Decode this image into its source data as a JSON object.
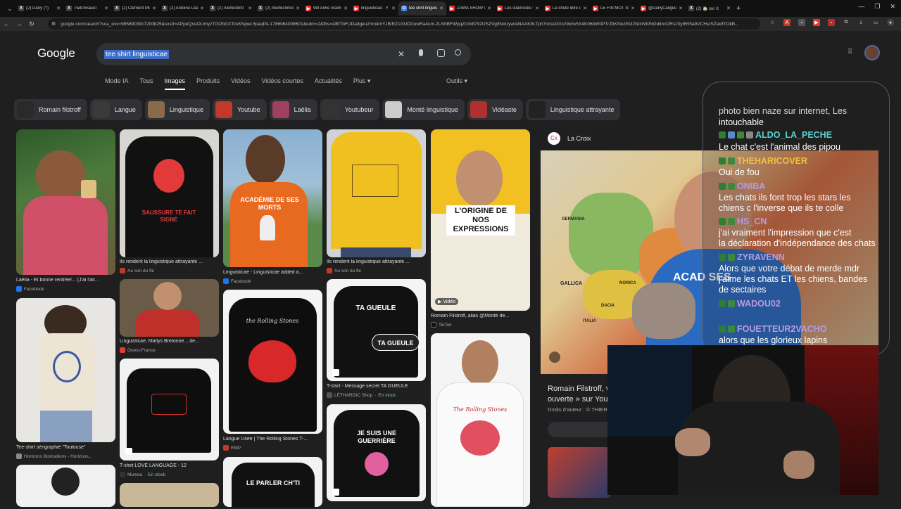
{
  "browser": {
    "tabs": [
      {
        "label": "(2) Dany (?)",
        "fav": "X",
        "color": "#444"
      },
      {
        "label": "TwitchSaucl",
        "fav": "X",
        "color": "#444"
      },
      {
        "label": "(2) Clément Mol",
        "fav": "X",
        "color": "#444"
      },
      {
        "label": "(2) Antoine Léau",
        "fav": "X",
        "color": "#444"
      },
      {
        "label": "(2) AlertesInfo",
        "fav": "X",
        "color": "#444"
      },
      {
        "label": "(2) AlertesInfos",
        "fav": "X",
        "color": "#444"
      },
      {
        "label": "Wil Aime vraiment",
        "fav": "▶",
        "color": "#e53935"
      },
      {
        "label": "linguisticae - Y",
        "fav": "▶",
        "color": "#e53935"
      },
      {
        "label": "tee shirt linguis",
        "fav": "G",
        "color": "#4285f4"
      },
      {
        "label": "ZAWA SHOW l",
        "fav": "▶",
        "color": "#e53935"
      },
      {
        "label": "Les islamistes s",
        "fav": "▶",
        "color": "#e53935"
      },
      {
        "label": "La chute libre d",
        "fav": "▶",
        "color": "#e53935"
      },
      {
        "label": "LE FIN MOT SUR",
        "fav": "▶",
        "color": "#e53935"
      },
      {
        "label": "@DanyCaligula",
        "fav": "▶",
        "color": "#e53935"
      },
      {
        "label": "(2) 🏠 sur X",
        "fav": "X",
        "color": "#444"
      }
    ],
    "active_tab": 8,
    "url": "google.com/search?sca_esv=98589039c7200b25&sxsrf=APpeQnuOUmyzTGl2bGXTcsKNpwL5paqPA:1786064008601&udm=2&fbs=ABfTbFUDadgeu2mn4mYJBIEZ1GUDDuwRa4um-2LNhBFWpqZc3x8792USZVg9NxUywAiNAAK9LTph7mlss0iXxz9ohv5X4K06bW0PTrZttKNuzlN32NixWI0NGdlmcDRs20y9Et5a9VCHsrSZsk8TOkB..."
  },
  "google": {
    "logo": "Google",
    "query": "tee shirt linguisticae",
    "tabs": [
      "Mode IA",
      "Tous",
      "Images",
      "Produits",
      "Vidéos",
      "Vidéos courtes",
      "Actualités",
      "Plus ▾"
    ],
    "active_tab": 2,
    "tools": "Outils ▾",
    "chips": [
      {
        "label": "Romain filstroff",
        "color": "#2a2a2a"
      },
      {
        "label": "Langue",
        "color": "#3a3a3a"
      },
      {
        "label": "Linguistique",
        "color": "#8a6a4a"
      },
      {
        "label": "Youtube",
        "color": "#c0392b"
      },
      {
        "label": "Laëlia",
        "color": "#a04060"
      },
      {
        "label": "Youtubeur",
        "color": "#333"
      },
      {
        "label": "Monté linguistique",
        "color": "#ccc"
      },
      {
        "label": "Vidéaste",
        "color": "#b03030"
      },
      {
        "label": "Linguistique attrayante",
        "color": "#222"
      }
    ]
  },
  "results": {
    "c1": [
      {
        "caption": "Laëlia - Et bonne rentrée!... (J'ai l'air...",
        "source": "Facebook",
        "src_color": "#1877f2"
      },
      {
        "caption": "Tee-shirt sérigraphié \"Toulouse\"",
        "source": "Horizons Illustrations - Horizons...",
        "src_color": "#888"
      }
    ],
    "c2": [
      {
        "caption": "Ils rendent la linguistique attrayante ...",
        "source": "Au son du fle",
        "src_color": "#c0392b",
        "tee_text": "SAUSSURE TE FAIT SIGNE"
      },
      {
        "caption": "Linguisticae, Maïlys Bretonne... de...",
        "source": "Ouest-France",
        "src_color": "#e53935"
      },
      {
        "caption": "T-shirt LOVE LANGUAGE - 12",
        "source": "Munwa",
        "stock": "En stock",
        "src_color": "#333"
      }
    ],
    "c3": [
      {
        "caption": "Linguisticae - Linguisticae added a...",
        "source": "Facebook",
        "src_color": "#1877f2",
        "tee_text": "ACADÉMIE DE SES MORTS"
      },
      {
        "caption": "Langue Usée | The Rolling Stones T-...",
        "source": "EMP",
        "src_color": "#c0392b",
        "tee_text": "the Rolling Stones"
      },
      {
        "tee_text": "LE PARLER CH'TI"
      }
    ],
    "c4": [
      {
        "caption": "Ils rendent la linguistique attrayante ...",
        "source": "Au son du fle",
        "src_color": "#c0392b"
      },
      {
        "caption": "T-shirt - Message secret TA GUEULE",
        "source": "LÉTHARGIC Shop",
        "stock": "En stock",
        "src_color": "#555",
        "tee_text": "TA GUEULE",
        "tee_text2": "TA GUEULE"
      },
      {
        "tee_text": "JE SUIS UNE GUERRIÈRE"
      }
    ],
    "c5": [
      {
        "caption": "Romain Filstroff, alias @Monté de...",
        "source": "TikTok",
        "src_color": "#111",
        "overlay": "L'ORIGINE DE NOS EXPRESSIONS",
        "badge": "Vidéo"
      },
      {
        "tee_text": "The Rolling Stones"
      }
    ]
  },
  "preview": {
    "source": "La Croix",
    "title": "Romain Filstroff, v",
    "subtitle": "ouverte » sur You",
    "rights": "Droits d'auteur : © THIER",
    "map_labels": [
      "GERMANIA",
      "GALLICA",
      "NORICA",
      "DACIA",
      "ITALIA"
    ],
    "shirt_text": "ACAD SES M"
  },
  "chat": {
    "messages": [
      {
        "name": "",
        "text": "photo bien naze sur internet, Les",
        "text2": "intouchable"
      },
      {
        "name": "ALDO_LA_PECHE",
        "color": "#5ad1d1",
        "text": "Le chat c'est l'animal des pipou"
      },
      {
        "name": "THEHARICOVER",
        "color": "#f0c040",
        "text": "Oui de fou"
      },
      {
        "name": "ONIBA",
        "color": "#b79be0",
        "text": "Les chats ils font trop les stars les",
        "text2": "chiens c l'inverse que ils te colle"
      },
      {
        "name": "HS_CN",
        "color": "#b79be0",
        "text": "j'ai vraiment l'impression que c'est",
        "text2": "la déclaration d'indépendance des chats"
      },
      {
        "name": "ZYRAVENN",
        "color": "#b79be0",
        "text": "Alors que votre débat de merde mdr",
        "text2": "j'aime les chats ET les chiens, bandes",
        "text3": "de sectaires"
      },
      {
        "name": "WADOU02",
        "color": "#b79be0",
        "text": ""
      },
      {
        "name": "FOUETTEUR2VACHO",
        "color": "#b79be0",
        "text": "alors que les glorieux lapins"
      }
    ]
  }
}
